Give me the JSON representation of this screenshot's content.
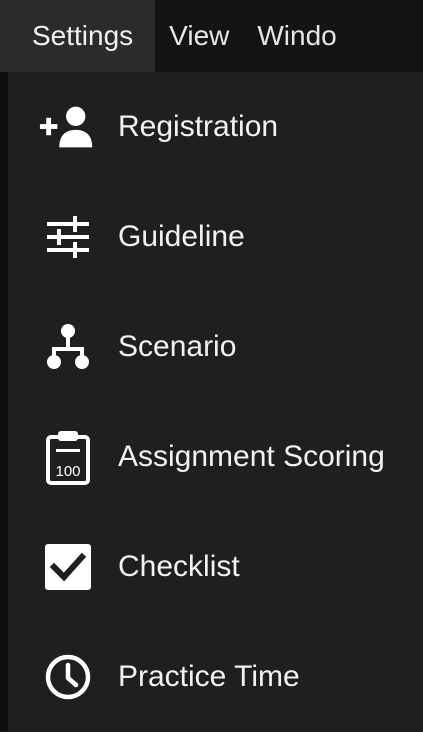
{
  "menubar": {
    "tabs": [
      {
        "label": "Settings"
      },
      {
        "label": "View"
      },
      {
        "label": "Windo"
      }
    ]
  },
  "menu": {
    "items": [
      {
        "label": "Registration",
        "icon": "add-user-icon"
      },
      {
        "label": "Guideline",
        "icon": "sliders-icon"
      },
      {
        "label": "Scenario",
        "icon": "hierarchy-icon"
      },
      {
        "label": "Assignment Scoring",
        "icon": "clipboard-100-icon"
      },
      {
        "label": "Checklist",
        "icon": "checkbox-icon"
      },
      {
        "label": "Practice Time",
        "icon": "clock-icon"
      }
    ]
  },
  "colors": {
    "background": "#1f1f1f",
    "menubar": "#141414",
    "active_tab": "#2b2b2b",
    "text": "#f2f2f2"
  }
}
